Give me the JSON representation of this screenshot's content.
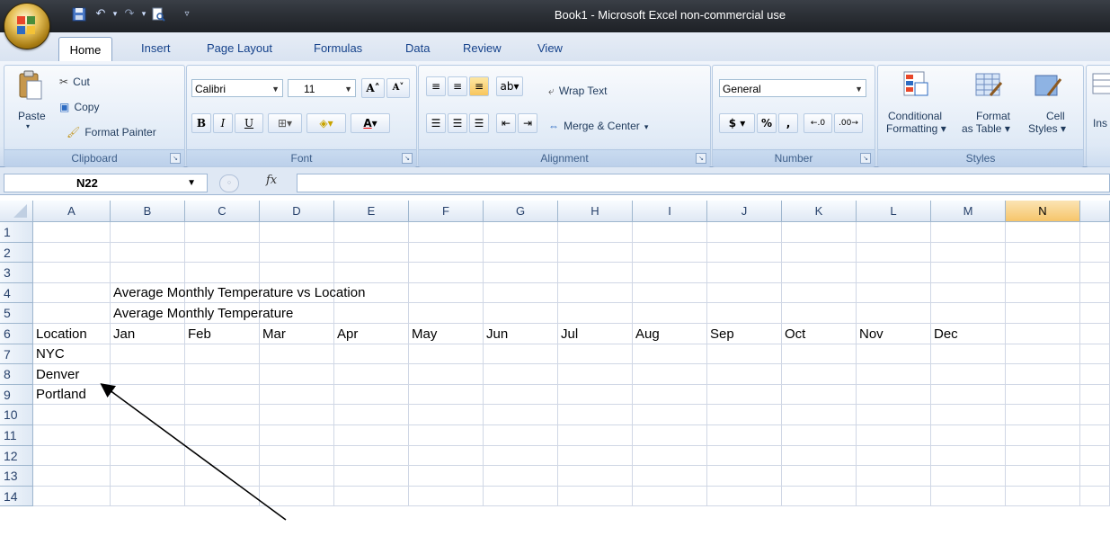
{
  "window": {
    "title": "Book1 - Microsoft Excel non-commercial use"
  },
  "tabs": [
    "Home",
    "Insert",
    "Page Layout",
    "Formulas",
    "Data",
    "Review",
    "View"
  ],
  "ribbon": {
    "clipboard": {
      "paste": "Paste",
      "cut": "Cut",
      "copy": "Copy",
      "format_painter": "Format Painter",
      "label": "Clipboard"
    },
    "font": {
      "name": "Calibri",
      "size": "11",
      "label": "Font",
      "bold": "B",
      "italic": "I",
      "underline": "U"
    },
    "alignment": {
      "wrap": "Wrap Text",
      "merge": "Merge & Center",
      "label": "Alignment"
    },
    "number": {
      "format": "General",
      "currency": "$",
      "percent": "%",
      "comma": ",",
      "label": "Number"
    },
    "styles": {
      "conditional_1": "Conditional",
      "conditional_2": "Formatting",
      "format_table_1": "Format",
      "format_table_2": "as Table",
      "cell_styles_1": "Cell",
      "cell_styles_2": "Styles",
      "label": "Styles"
    },
    "cells": {
      "insert": "Ins"
    }
  },
  "formula_bar": {
    "name_box": "N22",
    "fx": "fx",
    "value": ""
  },
  "grid": {
    "columns": [
      "A",
      "B",
      "C",
      "D",
      "E",
      "F",
      "G",
      "H",
      "I",
      "J",
      "K",
      "L",
      "M",
      "N"
    ],
    "selected_column": "N",
    "rows": [
      "1",
      "2",
      "3",
      "4",
      "5",
      "6",
      "7",
      "8",
      "9",
      "10",
      "11",
      "12",
      "13",
      "14"
    ],
    "cells": {
      "B4": "Average Monthly Temperature vs Location",
      "B5": "Average Monthly Temperature",
      "A6": "Location",
      "B6": "Jan",
      "C6": "Feb",
      "D6": "Mar",
      "E6": "Apr",
      "F6": "May",
      "G6": "Jun",
      "H6": "Jul",
      "I6": "Aug",
      "J6": "Sep",
      "K6": "Oct",
      "L6": "Nov",
      "M6": "Dec",
      "A7": "NYC",
      "A8": "Denver",
      "A9": "Portland"
    }
  },
  "annotation": {
    "arrow_target": "A7"
  },
  "colors": {
    "title_bar": "#2c3036",
    "ribbon": "#dfe9f5",
    "selected_header": "#f6c56a",
    "grid_line": "#d0d7e5"
  }
}
